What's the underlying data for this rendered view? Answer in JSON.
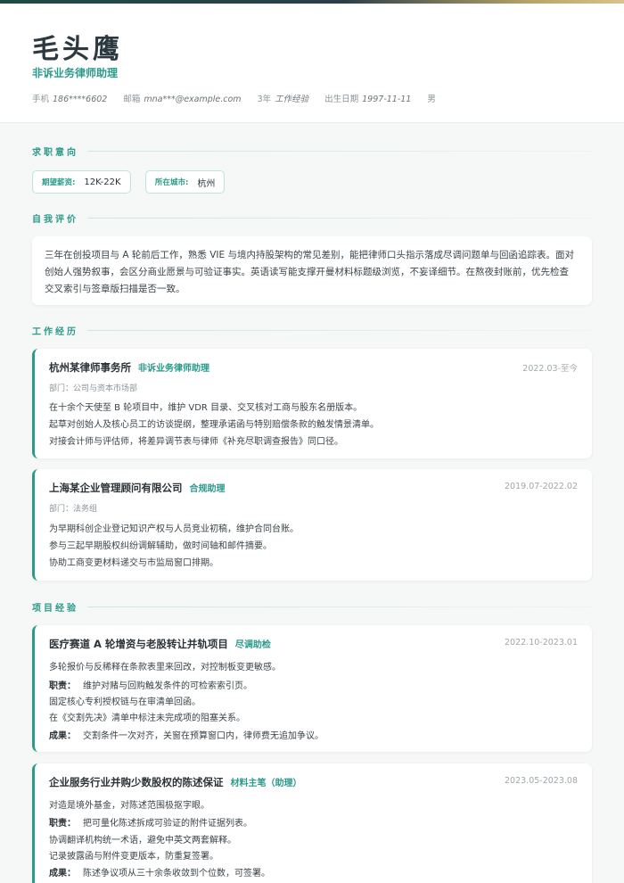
{
  "header": {
    "name": "毛头鹰",
    "title": "非诉业务律师助理",
    "phone_label": "手机",
    "phone": "186****6602",
    "email_label": "邮箱",
    "email": "mna***@example.com",
    "experience_years": "3年",
    "experience_label": "工作经验",
    "birth_label": "出生日期",
    "birth": "1997-11-11",
    "gender": "男"
  },
  "colors": {
    "accent": "#2a9a8a",
    "text": "#2b3338",
    "muted": "#8a9398"
  },
  "sections": {
    "intention": "求职意向",
    "self": "自我评价",
    "work": "工作经历",
    "project": "项目经验"
  },
  "intention": {
    "salary_label": "期望薪资:",
    "salary": "12K-22K",
    "city_label": "所在城市:",
    "city": "杭州"
  },
  "summary": {
    "lines": [
      "三年在创投项目与 A 轮前后工作，熟悉 VIE 与境内持股架构的常见差别，能把律师口头指示落成尽调问题单与回函追踪表。面对",
      "创始人强势叙事，会区分商业愿景与可验证事实。英语读写能支撑开曼材料标题级浏览，不妄译细节。在熬夜封账前，优先检查",
      "交叉索引与签章版扫描是否一致。"
    ]
  },
  "work": [
    {
      "company": "杭州某律师事务所",
      "role": "非诉业务律师助理",
      "date": "2022.03-至今",
      "dept": "部门：公司与资本市场部",
      "bullets": [
        "在十余个天使至 B 轮项目中，维护 VDR 目录、交叉核对工商与股东名册版本。",
        "起草对创始人及核心员工的访谈提纲，整理承诺函与特别赔偿条款的触发情景清单。",
        "对接会计师与评估师，将差异调节表与律师《补充尽职调查报告》同口径。"
      ]
    },
    {
      "company": "上海某企业管理顾问有限公司",
      "role": "合规助理",
      "date": "2019.07-2022.02",
      "dept": "部门：法务组",
      "bullets": [
        "为早期科创企业登记知识产权与人员竞业初稿，维护合同台账。",
        "参与三起早期股权纠纷调解辅助，做时间轴和邮件摘要。",
        "协助工商变更材料递交与市监局窗口排期。"
      ]
    }
  ],
  "projects": [
    {
      "name": "医疗赛道 A 轮增资与老股转让并轨项目",
      "role": "尽调助检",
      "date": "2022.10-2023.01",
      "desc": "多轮报价与反稀释在条款表里来回改，对控制板变更敏感。",
      "duty_label": "职责：",
      "duties": [
        "维护对赌与回购触发条件的可检索索引页。",
        "固定核心专利授权链与在审清单回函。",
        "在《交割先决》清单中标注未完成项的阻塞关系。"
      ],
      "result_label": "成果：",
      "result": "交割条件一次对齐，关窗在预算窗口内，律师费无追加争议。"
    },
    {
      "name": "企业服务行业并购少数股权的陈述保证",
      "role": "材料主笔（助理）",
      "date": "2023.05-2023.08",
      "desc": "对造是境外基金，对陈述范围极抠字眼。",
      "duty_label": "职责：",
      "duties": [
        "把可量化陈述拆成可验证的附件证据列表。",
        "协调翻译机构统一术语，避免中英文两套解释。",
        "记录披露函与附件变更版本，防重复签署。"
      ],
      "result_label": "成果：",
      "result": "陈述争议项从三十余条收敛到个位数，可签署。"
    }
  ]
}
